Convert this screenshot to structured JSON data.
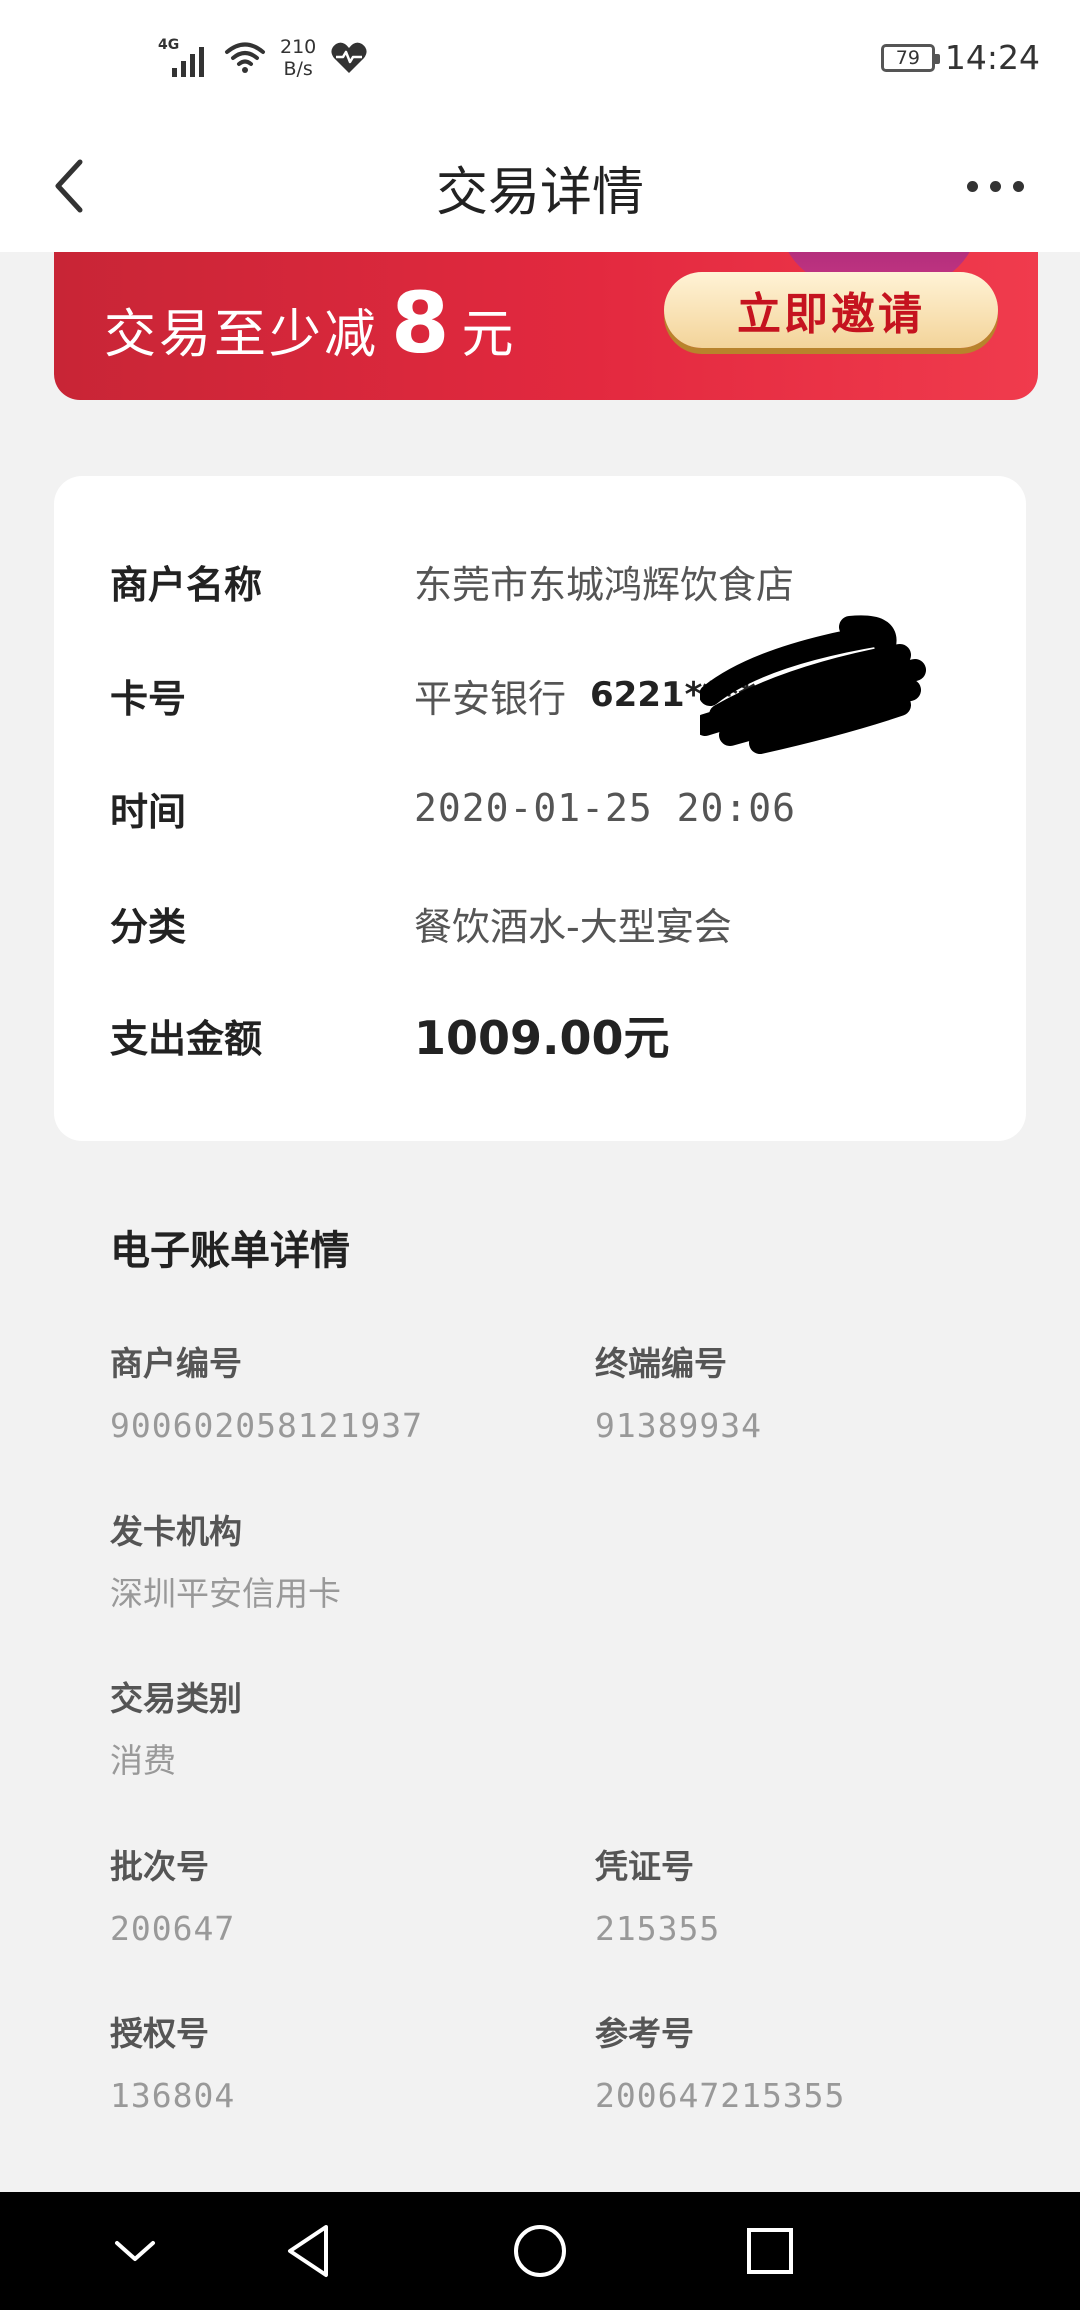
{
  "status_bar": {
    "network_type": "4G",
    "net_speed_value": "210",
    "net_speed_unit": "B/s",
    "battery_level": "79",
    "time": "14:24"
  },
  "header": {
    "title": "交易详情",
    "back_icon": "chevron-left-icon",
    "more_icon": "more-horizontal-icon"
  },
  "banner": {
    "text": "交易至少减",
    "amount": "8",
    "unit": "元",
    "button_label": "立即邀请",
    "colors": {
      "background": "#e3293f",
      "button_text": "#c5131f",
      "button_bg": "#f3d49a"
    }
  },
  "transaction": {
    "rows": [
      {
        "label": "商户名称",
        "value": "东莞市东城鸿辉饮食店"
      },
      {
        "label": "卡号",
        "bank": "平安银行",
        "card_number": "6221****"
      },
      {
        "label": "时间",
        "value": "2020-01-25 20:06"
      },
      {
        "label": "分类",
        "value": "餐饮酒水-大型宴会"
      },
      {
        "label": "支出金额",
        "value": "1009.00元"
      }
    ]
  },
  "bill": {
    "title": "电子账单详情",
    "merchant_id": {
      "label": "商户编号",
      "value": "900602058121937"
    },
    "terminal_id": {
      "label": "终端编号",
      "value": "91389934"
    },
    "issuer": {
      "label": "发卡机构",
      "value": "深圳平安信用卡"
    },
    "txn_type": {
      "label": "交易类别",
      "value": "消费"
    },
    "batch_no": {
      "label": "批次号",
      "value": "200647"
    },
    "voucher_no": {
      "label": "凭证号",
      "value": "215355"
    },
    "auth_no": {
      "label": "授权号",
      "value": "136804"
    },
    "reference_no": {
      "label": "参考号",
      "value": "200647215355"
    }
  },
  "system_nav": {
    "icons": [
      "chevron-down-icon",
      "back-triangle-icon",
      "home-circle-icon",
      "recents-square-icon"
    ]
  }
}
